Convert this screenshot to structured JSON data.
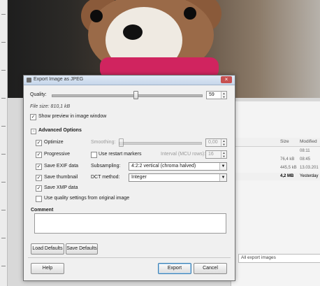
{
  "dialog": {
    "title": "Export Image as JPEG",
    "quality_label": "Quality:",
    "quality_value": "59",
    "quality_fraction": 0.59,
    "file_size": "File size: 810,1 kB",
    "show_preview_label": "Show preview in image window",
    "show_preview_checked": true,
    "advanced_options_label": "Advanced Options",
    "optimize_label": "Optimize",
    "optimize_checked": true,
    "smoothing_label": "Smoothing:",
    "smoothing_value": "0,00",
    "progressive_label": "Progressive",
    "progressive_checked": true,
    "restart_markers_label": "Use restart markers",
    "restart_markers_checked": false,
    "interval_label": "Interval (MCU rows):",
    "interval_value": "16",
    "save_exif_label": "Save EXIF data",
    "save_exif_checked": true,
    "subsampling_label": "Subsampling:",
    "subsampling_value": "4:2:2 vertical (chroma halved)",
    "save_thumbnail_label": "Save thumbnail",
    "save_thumbnail_checked": true,
    "dct_label": "DCT method:",
    "dct_value": "Integer",
    "save_xmp_label": "Save XMP data",
    "save_xmp_checked": true,
    "quality_settings_label": "Use quality settings from original image",
    "quality_settings_checked": false,
    "comment_label": "Comment",
    "comment_value": "",
    "load_defaults": "Load Defaults",
    "save_defaults": "Save Defaults",
    "help": "Help",
    "export": "Export",
    "cancel": "Cancel"
  },
  "background_window": {
    "col_size": "Size",
    "col_modified": "Modified",
    "rows": [
      {
        "size": "",
        "modified": "08:11",
        "selected": false
      },
      {
        "size": "76,4 kB",
        "modified": "08:45",
        "selected": false
      },
      {
        "size": "445,5 kB",
        "modified": "13.03.201",
        "selected": false
      },
      {
        "size": "4,2 MB",
        "modified": "Yesterday",
        "selected": true
      }
    ],
    "filter_value": "All export images"
  },
  "icons": [
    "dialog-app-icon",
    "close-icon",
    "expander-minus-icon",
    "chevron-down-icon",
    "spin-arrows-icon",
    "check-icon"
  ]
}
